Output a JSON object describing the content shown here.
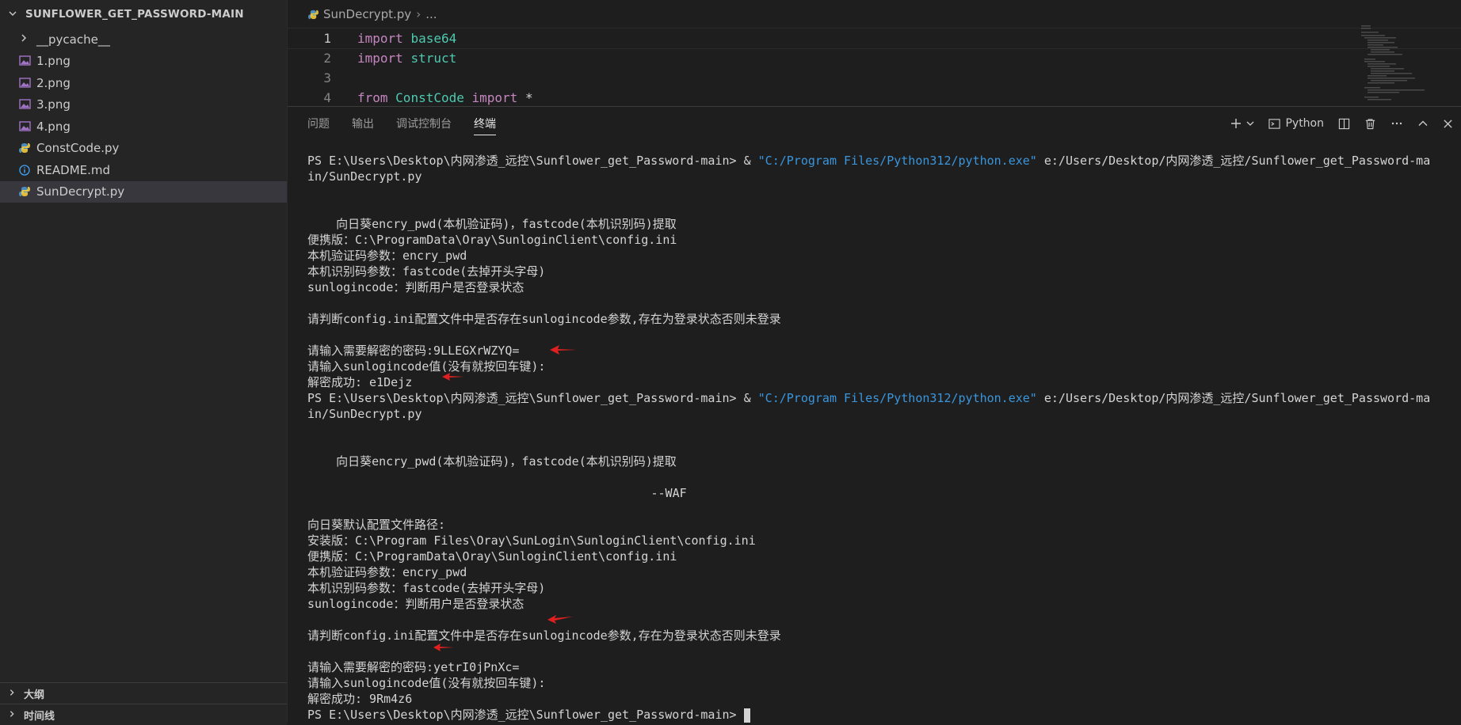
{
  "explorer": {
    "title": "SUNFLOWER_GET_PASSWORD-MAIN",
    "items": [
      {
        "label": "__pycache__",
        "type": "folder"
      },
      {
        "label": "1.png",
        "type": "image"
      },
      {
        "label": "2.png",
        "type": "image"
      },
      {
        "label": "3.png",
        "type": "image"
      },
      {
        "label": "4.png",
        "type": "image"
      },
      {
        "label": "ConstCode.py",
        "type": "python"
      },
      {
        "label": "README.md",
        "type": "info"
      },
      {
        "label": "SunDecrypt.py",
        "type": "python",
        "selected": true
      }
    ],
    "outline_label": "大纲",
    "timeline_label": "时间线"
  },
  "editor": {
    "breadcrumb_file": "SunDecrypt.py",
    "breadcrumb_more": "...",
    "lines": [
      {
        "num": "1",
        "kw": "import",
        "rest": "base64"
      },
      {
        "num": "2",
        "kw": "import",
        "rest": "struct"
      },
      {
        "num": "3",
        "kw": "",
        "rest": ""
      },
      {
        "num": "4",
        "kw": "from",
        "mod": "ConstCode",
        "kw2": "import",
        "rest": "*"
      }
    ]
  },
  "panel": {
    "tabs": [
      "问题",
      "输出",
      "调试控制台",
      "终端"
    ],
    "active_tab": "终端",
    "shell_label": "Python"
  },
  "terminal": {
    "cmd_prefix": "PS E:\\Users\\Desktop\\内网渗透_远控\\Sunflower_get_Password-main> & ",
    "cmd_exe": "\"C:/Program Files/Python312/python.exe\"",
    "cmd_script": " e:/Users/Desktop/内网渗透_远控/Sunflower_get_Password-ma",
    "cmd_wrap": "in/SunDecrypt.py",
    "run1": {
      "banner": "    向日葵encry_pwd(本机验证码)，fastcode(本机识别码)提取",
      "portable": "便携版：C:\\ProgramData\\Oray\\SunloginClient\\config.ini",
      "verify": "本机验证码参数：encry_pwd",
      "ident": "本机识别码参数：fastcode(去掉开头字母)",
      "sunlogin": "sunlogincode：判断用户是否登录状态",
      "judge": "请判断config.ini配置文件中是否存在sunlogincode参数,存在为登录状态否则未登录",
      "input_pwd": "请输入需要解密的密码:9LLEGXrWZYQ=",
      "input_code": "请输入sunlogincode值(没有就按回车键):",
      "result": "解密成功: e1Dejz"
    },
    "run2": {
      "banner": "    向日葵encry_pwd(本机验证码)，fastcode(本机识别码)提取",
      "author": "                                                --WAF",
      "default_path": "向日葵默认配置文件路径:",
      "install": "安装版：C:\\Program Files\\Oray\\SunLogin\\SunloginClient\\config.ini",
      "portable": "便携版：C:\\ProgramData\\Oray\\SunloginClient\\config.ini",
      "verify": "本机验证码参数：encry_pwd",
      "ident": "本机识别码参数：fastcode(去掉开头字母)",
      "sunlogin": "sunlogincode：判断用户是否登录状态",
      "judge": "请判断config.ini配置文件中是否存在sunlogincode参数,存在为登录状态否则未登录",
      "input_pwd": "请输入需要解密的密码:yetrI0jPnXc=",
      "input_code": "请输入sunlogincode值(没有就按回车键):",
      "result": "解密成功: 9Rm4z6"
    },
    "final_prompt": "PS E:\\Users\\Desktop\\内网渗透_远控\\Sunflower_get_Password-main> "
  },
  "colors": {
    "annotation_arrow": "#e02020",
    "terminal_link": "#3a96dd"
  }
}
